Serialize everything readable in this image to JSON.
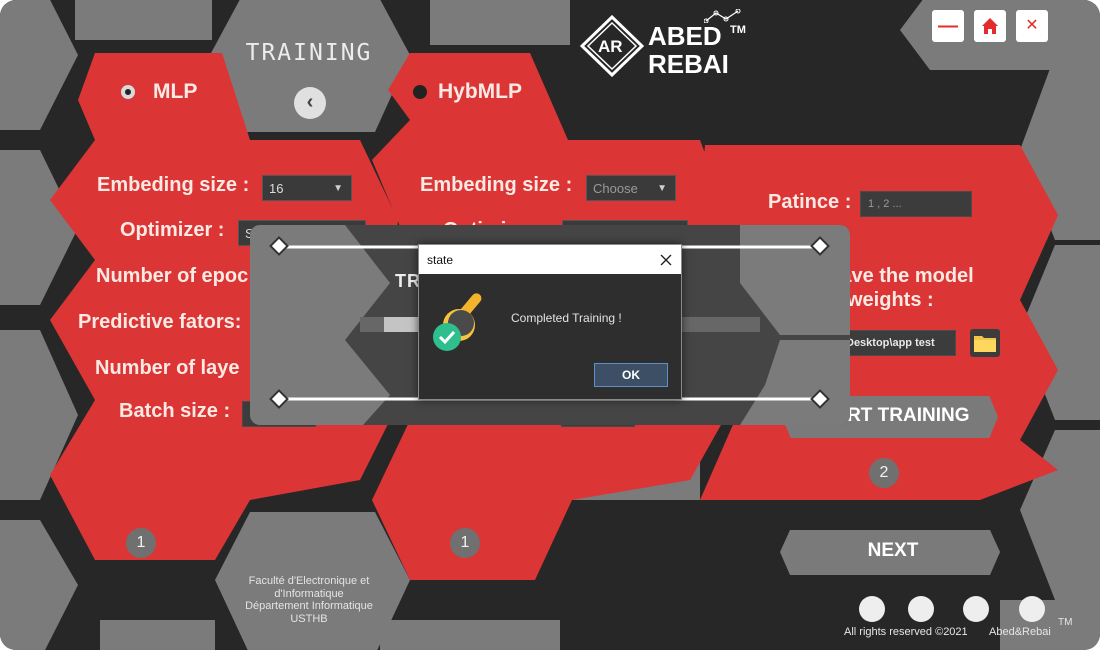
{
  "header": {
    "title": "TRAINING",
    "back_icon": "chevron-left-icon"
  },
  "logo": {
    "initials": "AR",
    "line1": "ABED",
    "line2": "REBAI",
    "trademark": "TM"
  },
  "window_controls": {
    "minimize": "—",
    "home_icon": "home-icon",
    "close": "✕"
  },
  "mlp": {
    "radio_label": "MLP",
    "selected": true,
    "embedding_label": "Embeding size :",
    "embedding_value": "16",
    "optimizer_label": "Optimizer :",
    "optimizer_value": "S",
    "epochs_label": "Number of epoc",
    "predictive_label": "Predictive fators:",
    "layers_label": "Number of laye",
    "batch_label": "Batch size :",
    "step": "1"
  },
  "hybmlp": {
    "radio_label": "HybMLP",
    "selected": false,
    "embedding_label": "Embeding size :",
    "embedding_placeholder": "Choose",
    "optimizer_label": "Optimizer :",
    "step": "1"
  },
  "right_panel": {
    "patience_label": "Patince :",
    "patience_placeholder": "1 , 2 ...",
    "save_label_line1": "Save the model",
    "save_label_line2": "weights :",
    "save_path": "Desktop\\app test",
    "folder_icon": "folder-icon",
    "start_button": "START TRAINING",
    "step": "2",
    "next_button": "NEXT"
  },
  "progress_overlay": {
    "title": "TRAINING ...",
    "progress_fraction": 0.1
  },
  "dialog": {
    "title": "state",
    "message": "Completed Training !",
    "ok_label": "OK",
    "close_icon": "close-icon",
    "icon": "brush-check-icon"
  },
  "faculty": {
    "line1": "Faculté d'Electronique et",
    "line2": "d'Informatique",
    "line3": "Département Informatique",
    "line4": "USTHB"
  },
  "footer": {
    "rights": "All rights reserved ©2021",
    "brand": "Abed&Rebai",
    "trademark": "TM"
  },
  "colors": {
    "background": "#272727",
    "red": "#dc3535",
    "grey_hex": "#7a7a7a",
    "text": "#fbe9e4"
  }
}
